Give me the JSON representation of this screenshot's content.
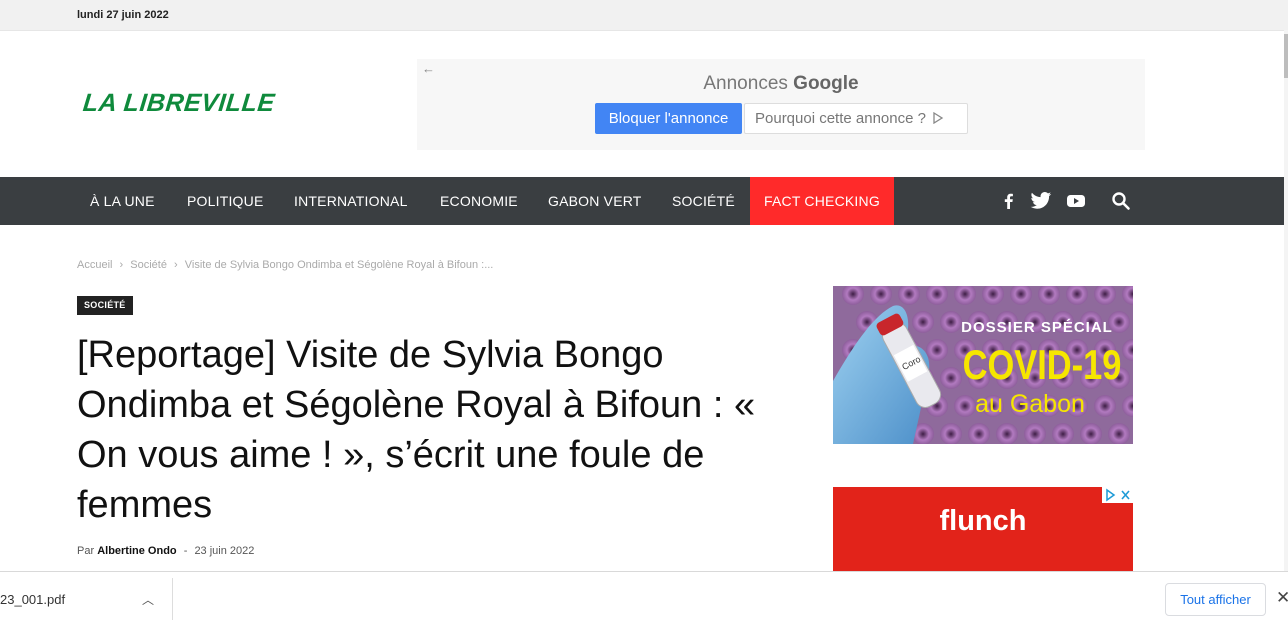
{
  "topbar": {
    "date": "lundi 27 juin 2022"
  },
  "site": {
    "logo": "LA LIBREVILLE"
  },
  "ad_banner": {
    "back_icon": "←",
    "label_prefix": "Annonces",
    "label_brand": "Google",
    "block_button": "Bloquer l'annonce",
    "why_button": "Pourquoi cette annonce ?"
  },
  "nav": {
    "items": [
      "À LA UNE",
      "POLITIQUE",
      "INTERNATIONAL",
      "ECONOMIE",
      "GABON VERT",
      "SOCIÉTÉ",
      "FACT CHECKING"
    ],
    "social_icons": [
      "facebook-icon",
      "twitter-icon",
      "youtube-icon",
      "search-icon"
    ],
    "fact_color": "#ff2a2a"
  },
  "breadcrumb": {
    "items": [
      "Accueil",
      "Société",
      "Visite de Sylvia Bongo Ondimba et Ségolène Royal à Bifoun :..."
    ],
    "separator": "›"
  },
  "article": {
    "category": "SOCIÉTÉ",
    "title": "[Reportage] Visite de Sylvia Bongo Ondimba et Ségolène Royal à Bifoun : « On vous aime ! », s’écrit une foule de femmes",
    "by_label": "Par",
    "author": "Albertine Ondo",
    "dash": "-",
    "date": "23 juin 2022"
  },
  "sidebar": {
    "covid_banner": {
      "line1": "DOSSIER SPÉCIAL",
      "line2": "COVID-19",
      "line3": "au Gabon",
      "tube_text": "Coro"
    },
    "flunch_ad": {
      "brand": "flunch"
    }
  },
  "downloads": {
    "file_name": "23_001.pdf",
    "show_all": "Tout afficher",
    "close": "✕",
    "chevron": "︿"
  },
  "colors": {
    "nav_bg": "#3a3e41",
    "logo_green": "#0f8a3c",
    "accent_red": "#ff2a2a"
  }
}
